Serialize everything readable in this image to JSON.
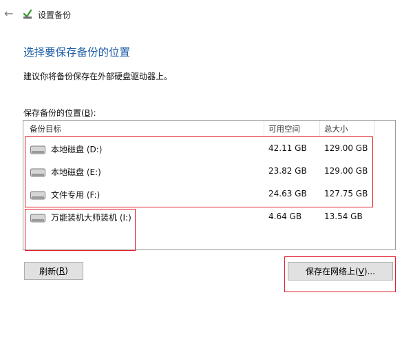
{
  "window": {
    "title": "设置备份"
  },
  "page": {
    "heading": "选择要保存备份的位置",
    "description": "建议你将备份保存在外部硬盘驱动器上。",
    "list_label_prefix": "保存备份的位置(",
    "list_label_key": "B",
    "list_label_suffix": "):"
  },
  "table": {
    "columns": [
      "备份目标",
      "可用空间",
      "总大小"
    ],
    "rows": [
      {
        "name": "本地磁盘 (D:)",
        "free": "42.11 GB",
        "total": "129.00 GB",
        "icon": "hard-drive-icon"
      },
      {
        "name": "本地磁盘 (E:)",
        "free": "23.82 GB",
        "total": "129.00 GB",
        "icon": "hard-drive-icon"
      },
      {
        "name": "文件专用 (F:)",
        "free": "24.63 GB",
        "total": "127.75 GB",
        "icon": "hard-drive-icon"
      },
      {
        "name": "万能装机大师装机 (I:)",
        "free": "4.64 GB",
        "total": "13.54 GB",
        "icon": "hard-drive-icon"
      }
    ]
  },
  "buttons": {
    "refresh_prefix": "刷新(",
    "refresh_key": "R",
    "refresh_suffix": ")",
    "network_prefix": "保存在网络上(",
    "network_key": "V",
    "network_suffix": ")..."
  },
  "colors": {
    "heading": "#1f5fa8",
    "highlight": "#e0202a"
  }
}
